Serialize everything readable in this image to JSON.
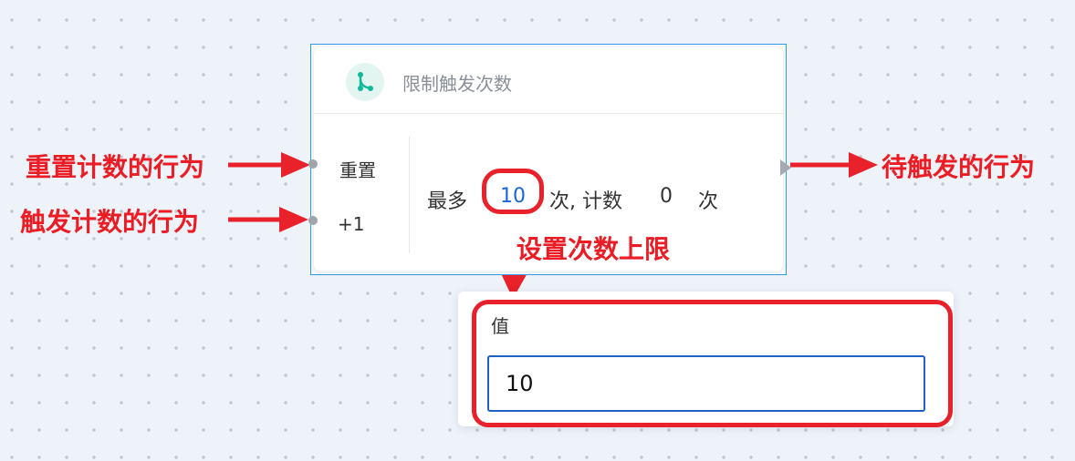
{
  "node": {
    "title": "限制触发次数",
    "inputs": {
      "reset_label": "重置",
      "increment_label": "+1"
    },
    "body": {
      "max_label": "最多",
      "max_value": "10",
      "times_label": "次, 计数",
      "count_value": "0",
      "times_label2": "次"
    }
  },
  "popup": {
    "label": "值",
    "input_value": "10"
  },
  "annotations": {
    "reset_behavior": "重置计数的行为",
    "trigger_behavior": "触发计数的行为",
    "output_behavior": "待触发的行为",
    "set_limit": "设置次数上限"
  },
  "colors": {
    "annotation": "#ec1c24",
    "selection": "#2f9be8",
    "link": "#1a66d9",
    "icon_accent": "#12b89a"
  },
  "icons": {
    "node_icon": "branch-icon"
  }
}
